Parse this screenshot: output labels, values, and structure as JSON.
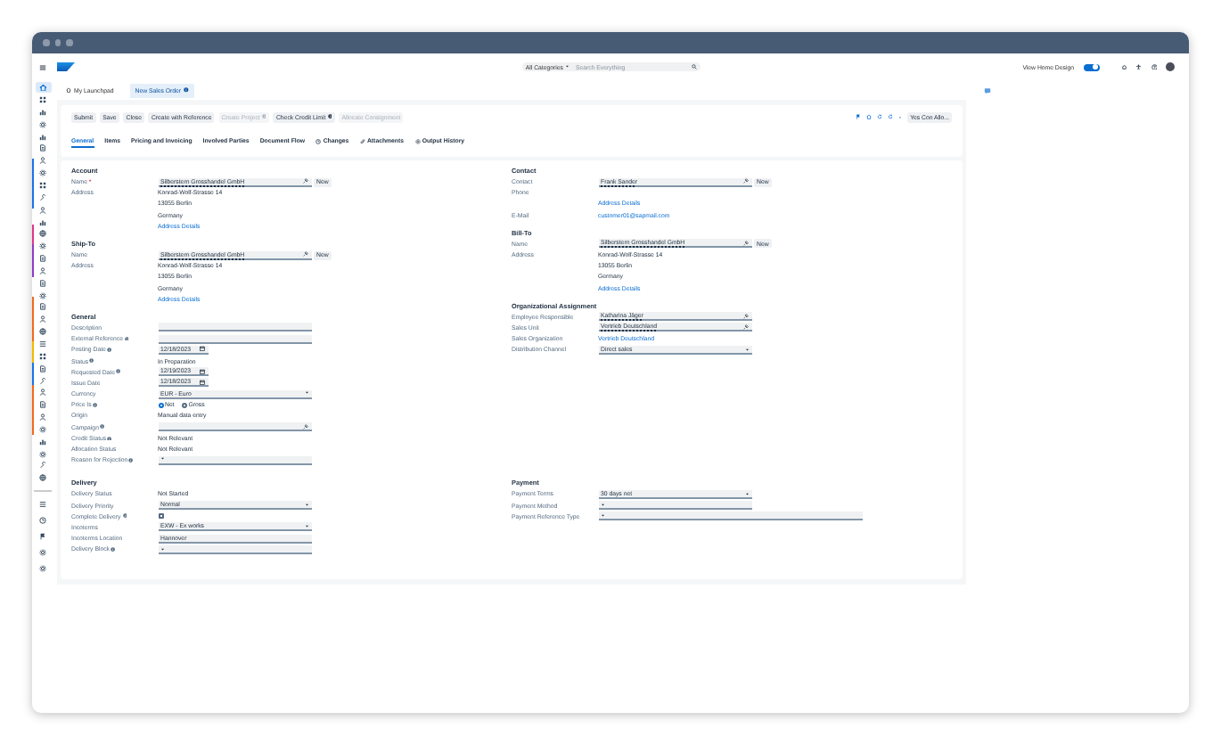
{
  "shell": {
    "search_scope": "All Categories",
    "search_placeholder": "Search Everything",
    "home_design": {
      "label": "View Home Design",
      "on": true
    }
  },
  "tabs": [
    {
      "label": "My Launchpad",
      "selected": false
    },
    {
      "label": "New Sales Order",
      "selected": true
    }
  ],
  "actions": [
    {
      "label": "Submit",
      "disabled": false
    },
    {
      "label": "Save",
      "disabled": false
    },
    {
      "label": "Close",
      "disabled": false
    },
    {
      "label": "Create with Reference",
      "disabled": false
    },
    {
      "label": "Create Project",
      "disabled": true
    },
    {
      "label": "Check Credit Limit",
      "disabled": false
    },
    {
      "label": "Allocate Consignment",
      "disabled": true
    }
  ],
  "header_button": "Yes Con Allo...",
  "object_tabs": [
    {
      "label": "General",
      "selected": true
    },
    {
      "label": "Items",
      "selected": false
    },
    {
      "label": "Pricing and Invoicing",
      "selected": false
    },
    {
      "label": "Involved Parties",
      "selected": false
    },
    {
      "label": "Document Flow",
      "selected": false
    },
    {
      "label": "Changes",
      "selected": false
    },
    {
      "label": "Attachments",
      "selected": false
    },
    {
      "label": "Output History",
      "selected": false
    }
  ],
  "form": {
    "rows": [
      {
        "left": [
          {
            "title": "Account",
            "fields": [
              {
                "label": "Name",
                "required_mark": "*",
                "kind": "lookup",
                "value": "Silberstern Grosshandel GmbH",
                "button": "New"
              },
              {
                "label": "Address",
                "kind": "lines",
                "lines": [
                  "Konrad-Wolf-Strasse 14",
                  "13055 Berlin",
                  "Germany"
                ]
              },
              {
                "kind": "link",
                "value": "Address Details"
              }
            ]
          },
          {
            "title": "Ship-To",
            "fields": [
              {
                "label": "Name",
                "kind": "lookup",
                "value": "Silberstern Grosshandel GmbH",
                "button": "New"
              },
              {
                "label": "Address",
                "kind": "lines",
                "lines": [
                  "Konrad-Wolf-Strasse 14",
                  "13055 Berlin",
                  "Germany"
                ]
              },
              {
                "kind": "link",
                "value": "Address Details"
              }
            ]
          },
          {
            "title": "General",
            "fields": [
              {
                "label": "Description",
                "kind": "input"
              },
              {
                "label": "External Reference",
                "info": true,
                "kind": "input"
              },
              {
                "label": "Posting Date",
                "info": true,
                "kind": "date",
                "value": "12/18/2023"
              },
              {
                "label": "Status",
                "info": true,
                "kind": "text",
                "value": "In Preparation"
              },
              {
                "label": "Requested Date",
                "info": true,
                "kind": "date",
                "value": "12/19/2023"
              },
              {
                "label": "Issue Date",
                "kind": "date",
                "value": "12/18/2023"
              },
              {
                "label": "Currency",
                "kind": "select",
                "value": "EUR - Euro"
              },
              {
                "label": "Price Is",
                "info": true,
                "kind": "radio",
                "options": [
                  {
                    "label": "Net",
                    "selected": true
                  },
                  {
                    "label": "Gross",
                    "selected": false
                  }
                ]
              },
              {
                "label": "Origin",
                "kind": "text",
                "value": "Manual data entry"
              },
              {
                "label": "Campaign",
                "info": true,
                "kind": "lookup"
              },
              {
                "label": "Credit Status",
                "info": true,
                "kind": "text",
                "value": "Not Relevant"
              },
              {
                "label": "Allocation Status",
                "kind": "text",
                "value": "Not Relevant"
              },
              {
                "label": "Reason for Rejection",
                "info": true,
                "kind": "select"
              }
            ]
          }
        ],
        "right": [
          {
            "title": "Contact",
            "fields": [
              {
                "label": "Contact",
                "kind": "lookup",
                "value": "Frank Sander",
                "button": "New"
              },
              {
                "label": "Phone",
                "kind": "text"
              },
              {
                "kind": "link",
                "value": "Address Details"
              },
              {
                "label": "E-Mail",
                "kind": "link",
                "value": "customer01@sapmail.com"
              }
            ]
          },
          {
            "title": "Bill-To",
            "fields": [
              {
                "label": "Name",
                "kind": "lookup",
                "value": "Silberstern Grosshandel GmbH",
                "button": "New"
              },
              {
                "label": "Address",
                "kind": "lines",
                "lines": [
                  "Konrad-Wolf-Strasse 14",
                  "13055 Berlin",
                  "Germany"
                ]
              },
              {
                "kind": "link",
                "value": "Address Details"
              }
            ]
          },
          {
            "title": "Organizational Assignment",
            "fields": [
              {
                "label": "Employee Responsible",
                "kind": "lookup",
                "value": "Katharina Jäger"
              },
              {
                "label": "Sales Unit",
                "kind": "lookup",
                "value": "Vertrieb Deutschland"
              },
              {
                "label": "Sales Organization",
                "kind": "link",
                "value": "Vertrieb Deutschland"
              },
              {
                "label": "Distribution Channel",
                "kind": "select",
                "value": "Direct sales"
              }
            ]
          }
        ]
      },
      {
        "left": [
          {
            "title": "Delivery",
            "fields": [
              {
                "label": "Delivery Status",
                "kind": "text",
                "value": "Not Started"
              },
              {
                "label": "Delivery Priority",
                "kind": "select",
                "value": "Normal"
              },
              {
                "label": "Complete Delivery",
                "info": true,
                "kind": "checkbox",
                "checked": false
              },
              {
                "label": "Incoterms",
                "kind": "select",
                "value": "EXW - Ex works"
              },
              {
                "label": "Incoterms Location",
                "kind": "input",
                "value": "Hannover"
              },
              {
                "label": "Delivery Block",
                "info": true,
                "kind": "select"
              }
            ]
          }
        ],
        "right": [
          {
            "title": "Payment",
            "fields": [
              {
                "label": "Payment Terms",
                "kind": "select",
                "value": "30 days net"
              },
              {
                "label": "Payment Method",
                "kind": "select"
              },
              {
                "label": "Payment Reference Type",
                "kind": "select",
                "wide": true
              }
            ]
          }
        ]
      }
    ]
  }
}
